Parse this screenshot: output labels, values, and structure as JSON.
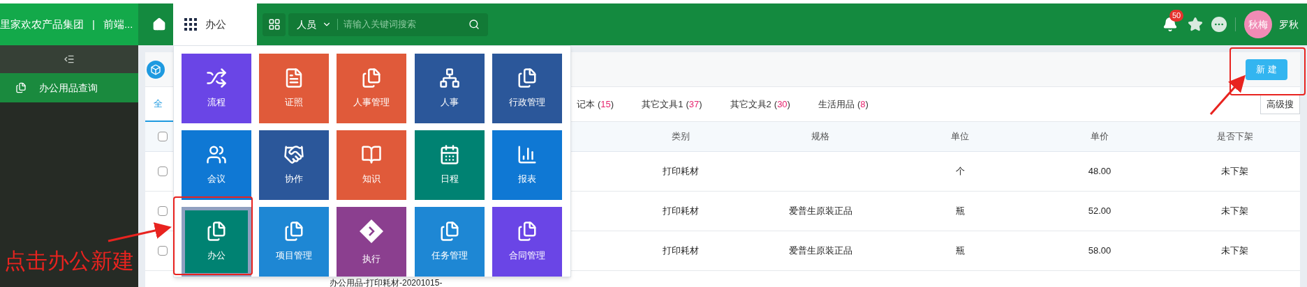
{
  "brand": {
    "company": "里家欢农产品集团",
    "separator": "|",
    "app": "前端..."
  },
  "sidebar": {
    "items": [
      {
        "label": "办公用品查询",
        "selected": true
      }
    ]
  },
  "top_bar": {
    "module": "办公",
    "search": {
      "scope": "人员",
      "placeholder": "请输入关键词搜索"
    },
    "notifications": "50",
    "user": {
      "avatar": "秋梅",
      "name": "罗秋"
    }
  },
  "module_menu": {
    "tiles": [
      {
        "label": "流程",
        "color": "#6a45e6",
        "selected": false
      },
      {
        "label": "证照",
        "color": "#e05a3a",
        "selected": false
      },
      {
        "label": "人事管理",
        "color": "#e05a3a",
        "selected": false
      },
      {
        "label": "人事",
        "color": "#2b579a",
        "selected": false
      },
      {
        "label": "行政管理",
        "color": "#2b579a",
        "selected": false
      },
      {
        "label": "会议",
        "color": "#0f78d4",
        "selected": false
      },
      {
        "label": "协作",
        "color": "#2b579a",
        "selected": false
      },
      {
        "label": "知识",
        "color": "#e05a3a",
        "selected": false
      },
      {
        "label": "日程",
        "color": "#008272",
        "selected": false
      },
      {
        "label": "报表",
        "color": "#0f78d4",
        "selected": false
      },
      {
        "label": "办公",
        "color": "#008272",
        "selected": true
      },
      {
        "label": "项目管理",
        "color": "#1e87d4",
        "selected": false
      },
      {
        "label": "执行",
        "color": "#8b3f8f",
        "selected": false
      },
      {
        "label": "任务管理",
        "color": "#1e87d4",
        "selected": false
      },
      {
        "label": "合同管理",
        "color": "#6a45e6",
        "selected": false
      }
    ]
  },
  "header": {
    "new_button": "新 建"
  },
  "tabs": [
    {
      "label": "全",
      "selected": true
    },
    {
      "label": "记本",
      "open": "(",
      "count": "15",
      "close": ")",
      "selected": false
    },
    {
      "label": "其它文具1",
      "open": "(",
      "count": "37",
      "close": ")",
      "selected": false
    },
    {
      "label": "其它文具2",
      "open": "(",
      "count": "30",
      "close": ")",
      "selected": false
    },
    {
      "label": "生活用品",
      "open": "(",
      "count": "8",
      "close": ")",
      "selected": false
    }
  ],
  "advanced_search": "高级搜",
  "table": {
    "select_all_checked": false,
    "columns": [
      "类别",
      "规格",
      "单位",
      "单价",
      "是否下架"
    ],
    "rows": [
      {
        "checked": false,
        "cells": [
          "打印耗材",
          "",
          "个",
          "48.00",
          "未下架"
        ]
      },
      {
        "checked": false,
        "cells": [
          "打印耗材",
          "爱普生原装正品",
          "瓶",
          "52.00",
          "未下架"
        ]
      },
      {
        "checked": false,
        "cells": [
          "打印耗材",
          "爱普生原装正品",
          "瓶",
          "58.00",
          "未下架"
        ]
      }
    ],
    "partial_row": {
      "name": "办公用品-打印耗材-20201015-"
    }
  },
  "annotation": {
    "text": "点击办公新建"
  }
}
